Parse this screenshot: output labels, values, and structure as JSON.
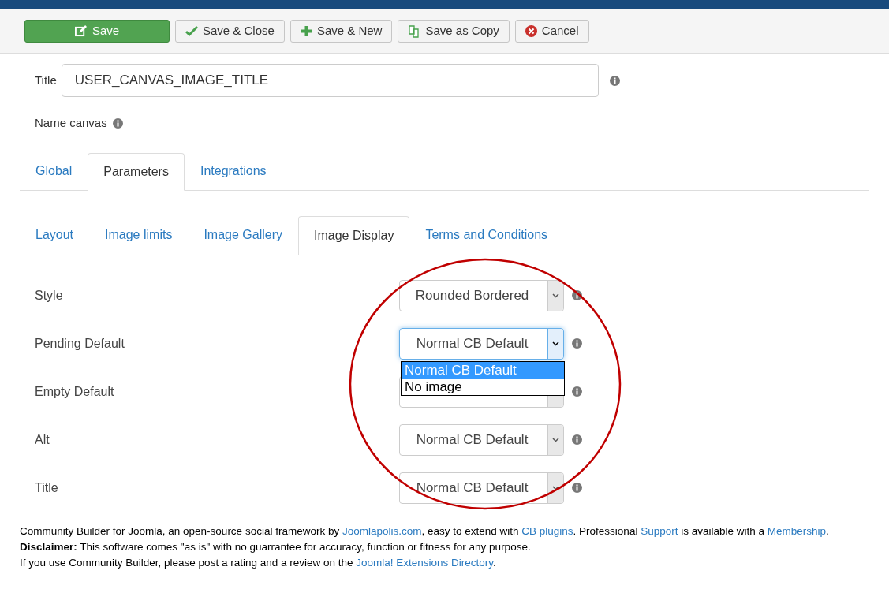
{
  "toolbar": {
    "buttons": [
      {
        "kind": "save",
        "label": "Save"
      },
      {
        "kind": "close",
        "label": "Save & Close"
      },
      {
        "kind": "new",
        "label": "Save & New"
      },
      {
        "kind": "copy",
        "label": "Save as Copy"
      },
      {
        "kind": "cancel",
        "label": "Cancel"
      }
    ]
  },
  "title_field": {
    "label": "Title",
    "value": "USER_CANVAS_IMAGE_TITLE"
  },
  "name_label": "Name canvas",
  "tabs": [
    {
      "label": "Global",
      "selected": false
    },
    {
      "label": "Parameters",
      "selected": true
    },
    {
      "label": "Integrations",
      "selected": false
    }
  ],
  "subtabs": [
    {
      "label": "Layout",
      "selected": false
    },
    {
      "label": "Image limits",
      "selected": false
    },
    {
      "label": "Image Gallery",
      "selected": false
    },
    {
      "label": "Image Display",
      "selected": true
    },
    {
      "label": "Terms and Conditions",
      "selected": false
    }
  ],
  "fields": [
    {
      "label": "Style",
      "value": "Rounded Bordered",
      "focused": false
    },
    {
      "label": "Pending Default",
      "value": "Normal CB Default",
      "focused": true,
      "options": [
        {
          "label": "Normal CB Default",
          "selected": true
        },
        {
          "label": "No image",
          "selected": false
        }
      ]
    },
    {
      "label": "Empty Default",
      "focused": false
    },
    {
      "label": "Alt",
      "value": "Normal CB Default",
      "focused": false
    },
    {
      "label": "Title",
      "value": "Normal CB Default",
      "focused": false
    }
  ],
  "footer": [
    [
      {
        "text": "Community Builder for Joomla, an open-source social framework by "
      },
      {
        "text": "Joomlapolis.com",
        "link": true
      },
      {
        "text": ", easy to extend with "
      },
      {
        "text": "CB plugins",
        "link": true
      },
      {
        "text": ". Professional "
      },
      {
        "text": "Support",
        "link": true
      },
      {
        "text": " is available with a "
      },
      {
        "text": "Membership",
        "link": true
      },
      {
        "text": "."
      }
    ],
    [
      {
        "text": "Disclaimer:",
        "bold": true
      },
      {
        "text": " This software comes \"as is\" with no guarrantee for accuracy, function or fitness for any purpose."
      }
    ],
    [
      {
        "text": "If you use Community Builder, please post a rating and a review on the "
      },
      {
        "text": "Joomla! Extensions Directory",
        "link": true
      },
      {
        "text": "."
      }
    ]
  ]
}
